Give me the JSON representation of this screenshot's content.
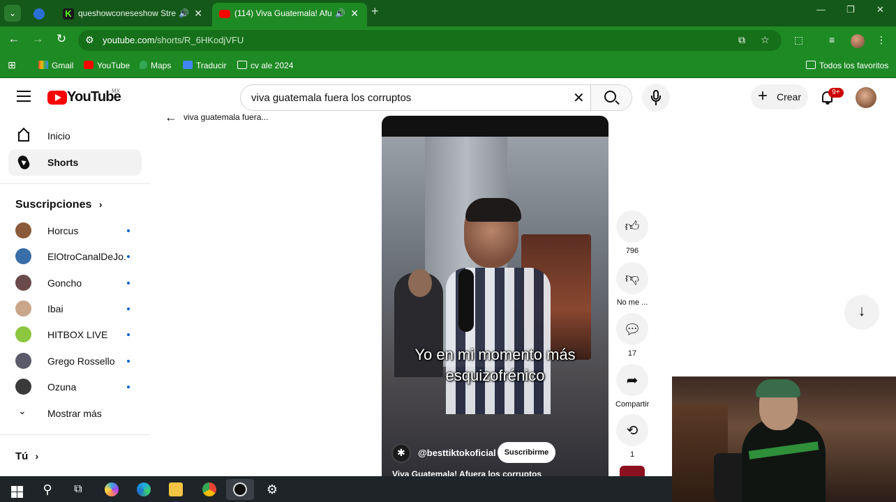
{
  "browser": {
    "tabs": [
      {
        "title": "",
        "favicon_color": "#2a6fd6"
      },
      {
        "title": "queshowconeseshow Strea",
        "favicon_color": "#53fc18"
      },
      {
        "title": "(114) Viva Guatemala! Afue",
        "favicon_color": "#ff0000"
      }
    ],
    "url_host": "youtube.com",
    "url_path": "/shorts/R_6HKodjVFU",
    "bookmarks": [
      "Gmail",
      "YouTube",
      "Maps",
      "Traducir",
      "cv ale 2024"
    ],
    "all_bookmarks": "Todos los favoritos",
    "theme_color": "#1e8a24"
  },
  "youtube": {
    "logo_text": "YouTube",
    "region": "MX",
    "search_query": "viva guatemala fuera los corruptos",
    "create_label": "Crear",
    "notifications_badge": "9+"
  },
  "sidebar": {
    "nav": [
      {
        "label": "Inicio",
        "icon": "home-icon"
      },
      {
        "label": "Shorts",
        "icon": "shorts-icon"
      }
    ],
    "subs_heading": "Suscripciones",
    "subscriptions": [
      {
        "name": "Horcus",
        "avatar_color": "#8a5a3a"
      },
      {
        "name": "ElOtroCanalDeJo...",
        "avatar_color": "#3a6ea8"
      },
      {
        "name": "Goncho",
        "avatar_color": "#6a4a4a"
      },
      {
        "name": "Ibai",
        "avatar_color": "#c9a58a"
      },
      {
        "name": "HITBOX LIVE",
        "avatar_color": "#8dc63f"
      },
      {
        "name": "Grego Rossello",
        "avatar_color": "#5a5a6a"
      },
      {
        "name": "Ozuna",
        "avatar_color": "#3a3a3a"
      }
    ],
    "show_more": "Mostrar más",
    "you_heading": "Tú"
  },
  "short": {
    "back_title": "viva guatemala fuera...",
    "caption_line1": "Yo en mi momento más",
    "caption_line2": "esquizofrénico",
    "channel": "@besttiktokoficial",
    "subscribe_label": "Suscribirme",
    "title": "Viva Guatemala! Afuera los corruptos",
    "actions": [
      {
        "id": "like",
        "label": "796",
        "icon": "thumbs-up-icon"
      },
      {
        "id": "dislike",
        "label": "No me ...",
        "icon": "thumbs-down-icon"
      },
      {
        "id": "comments",
        "label": "17",
        "icon": "comment-icon"
      },
      {
        "id": "share",
        "label": "Compartir",
        "icon": "share-icon"
      },
      {
        "id": "remix",
        "label": "1",
        "icon": "remix-icon"
      }
    ]
  }
}
